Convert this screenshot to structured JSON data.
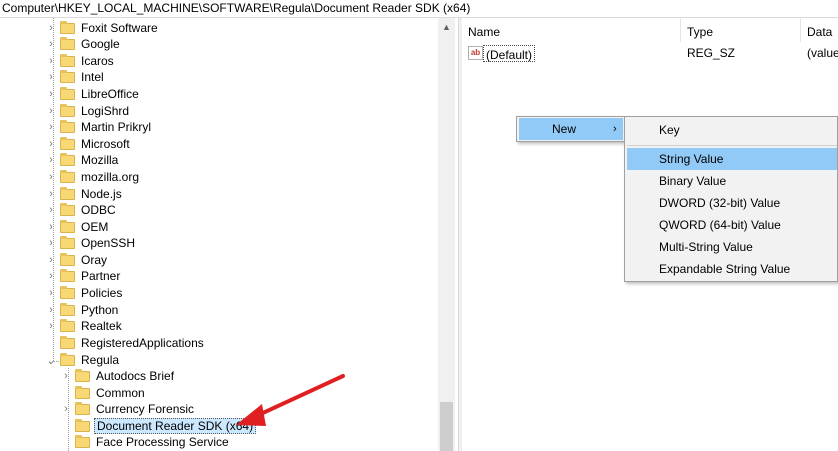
{
  "address": "Computer\\HKEY_LOCAL_MACHINE\\SOFTWARE\\Regula\\Document Reader SDK (x64)",
  "tree": {
    "items": [
      {
        "label": "Foxit Software"
      },
      {
        "label": "Google"
      },
      {
        "label": "Icaros"
      },
      {
        "label": "Intel"
      },
      {
        "label": "LibreOffice"
      },
      {
        "label": "LogiShrd"
      },
      {
        "label": "Martin Prikryl"
      },
      {
        "label": "Microsoft"
      },
      {
        "label": "Mozilla"
      },
      {
        "label": "mozilla.org"
      },
      {
        "label": "Node.js"
      },
      {
        "label": "ODBC"
      },
      {
        "label": "OEM"
      },
      {
        "label": "OpenSSH"
      },
      {
        "label": "Oray"
      },
      {
        "label": "Partner"
      },
      {
        "label": "Policies"
      },
      {
        "label": "Python"
      },
      {
        "label": "Realtek"
      },
      {
        "label": "RegisteredApplications"
      },
      {
        "label": "Regula"
      }
    ],
    "children": [
      {
        "label": "Autodocs Brief"
      },
      {
        "label": "Common"
      },
      {
        "label": "Currency Forensic"
      },
      {
        "label": "Document Reader SDK (x64)"
      },
      {
        "label": "Face Processing Service"
      }
    ]
  },
  "list": {
    "columns": {
      "name": "Name",
      "type": "Type",
      "data": "Data"
    },
    "rows": [
      {
        "name": "(Default)",
        "type": "REG_SZ",
        "data": "(value"
      }
    ],
    "icon": "string-value-icon"
  },
  "context_menu": {
    "new_label": "New",
    "submenu": [
      {
        "label": "Key"
      },
      {
        "label": "String Value"
      },
      {
        "label": "Binary Value"
      },
      {
        "label": "DWORD (32-bit) Value"
      },
      {
        "label": "QWORD (64-bit) Value"
      },
      {
        "label": "Multi-String Value"
      },
      {
        "label": "Expandable String Value"
      }
    ]
  },
  "colors": {
    "highlight": "#91c9f7",
    "selection": "#cce8ff",
    "folder": "#f8d775",
    "annotation_arrow": "#e02020"
  }
}
